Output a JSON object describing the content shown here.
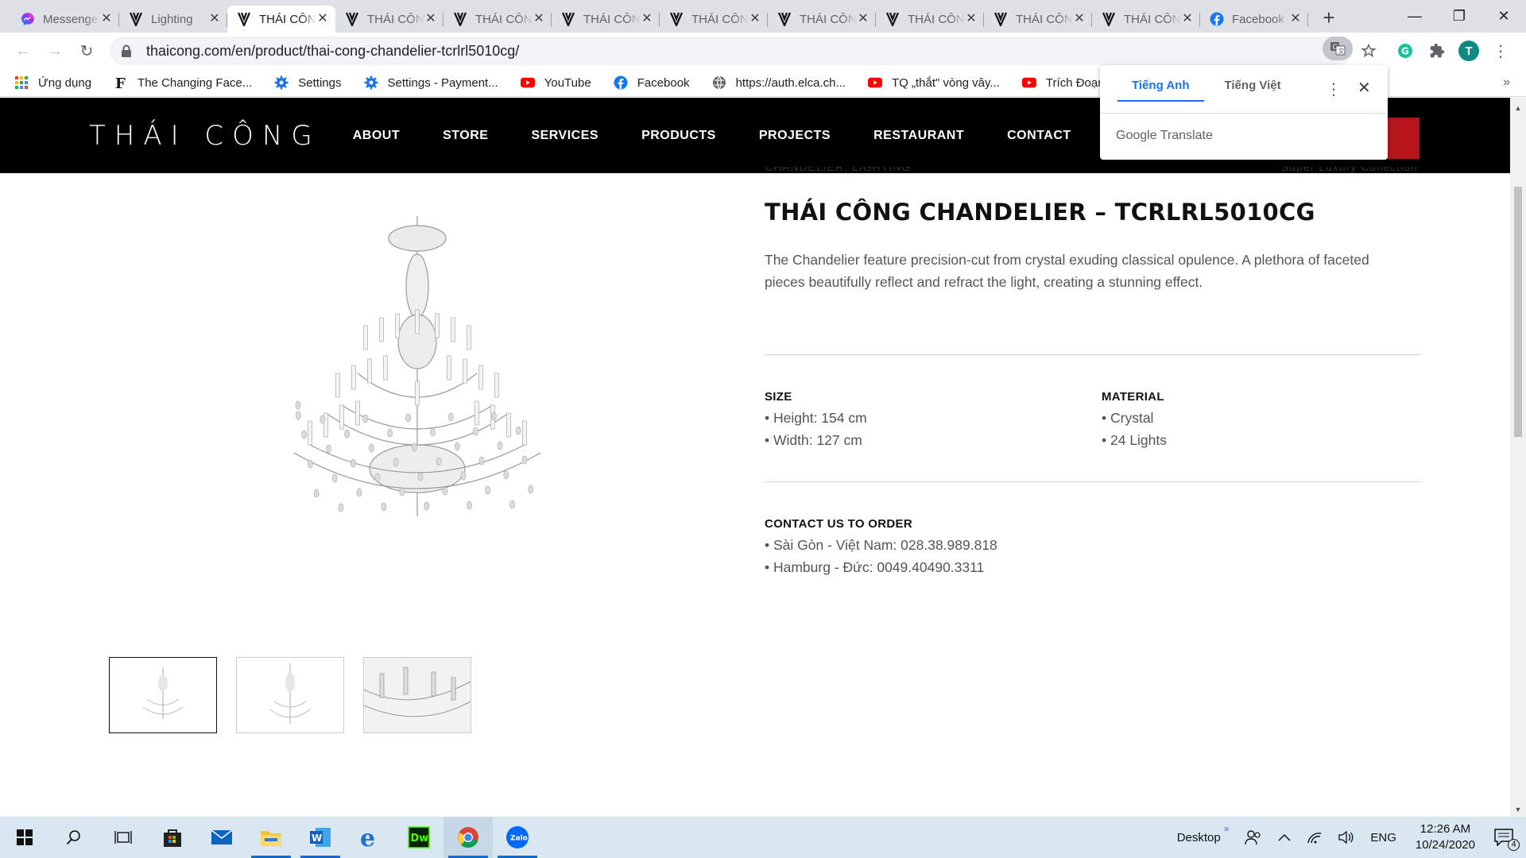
{
  "browser": {
    "tabs": [
      {
        "title": "Messenger",
        "icon": "messenger-icon",
        "active": false
      },
      {
        "title": "Lighting",
        "icon": "thaicong-icon",
        "active": false
      },
      {
        "title": "THÁI CÔNG",
        "icon": "thaicong-icon",
        "active": true
      },
      {
        "title": "THÁI CÔNG",
        "icon": "thaicong-icon",
        "active": false
      },
      {
        "title": "THÁI CÔNG",
        "icon": "thaicong-icon",
        "active": false
      },
      {
        "title": "THÁI CÔNG",
        "icon": "thaicong-icon",
        "active": false
      },
      {
        "title": "THÁI CÔNG",
        "icon": "thaicong-icon",
        "active": false
      },
      {
        "title": "THÁI CÔNG",
        "icon": "thaicong-icon",
        "active": false
      },
      {
        "title": "THÁI CÔNG",
        "icon": "thaicong-icon",
        "active": false
      },
      {
        "title": "THÁI CÔNG",
        "icon": "thaicong-icon",
        "active": false
      },
      {
        "title": "THÁI CÔNG",
        "icon": "thaicong-icon",
        "active": false
      },
      {
        "title": "Facebook",
        "icon": "facebook-icon",
        "active": false
      }
    ],
    "url": "thaicong.com/en/product/thai-cong-chandelier-tcrlrl5010cg/",
    "profile_initial": "T",
    "bookmarks": [
      {
        "label": "Ứng dụng",
        "icon": "apps-grid-icon"
      },
      {
        "label": "The Changing Face...",
        "icon": "f-logo-icon"
      },
      {
        "label": "Settings",
        "icon": "gear-icon"
      },
      {
        "label": "Settings - Payment...",
        "icon": "gear-icon"
      },
      {
        "label": "YouTube",
        "icon": "youtube-icon"
      },
      {
        "label": "Facebook",
        "icon": "facebook-icon"
      },
      {
        "label": "https://auth.elca.ch...",
        "icon": "globe-icon"
      },
      {
        "label": "TQ „thắt\" vòng vây...",
        "icon": "youtube-icon"
      },
      {
        "label": "Trích Đoạn Đêm lạ...",
        "icon": "youtube-icon"
      }
    ]
  },
  "translate_popup": {
    "tab_source": "Tiếng Anh",
    "tab_target": "Tiếng Việt",
    "brand": "Google Translate"
  },
  "site": {
    "logo": "THÁI CÔNG",
    "nav": [
      "ABOUT",
      "STORE",
      "SERVICES",
      "PRODUCTS",
      "PROJECTS",
      "RESTAURANT",
      "CONTACT"
    ],
    "accent": "#b4161b"
  },
  "product": {
    "category_cut": "CHANDELIER, LIGHTING",
    "collection_cut": "Super Luxury Collection",
    "title": "THÁI CÔNG CHANDELIER – TCRLRL5010CG",
    "description": "The Chandelier feature precision-cut from crystal exuding classical opulence. A plethora of faceted pieces beautifully reflect and refract the light, creating a stunning effect.",
    "size_heading": "SIZE",
    "size_lines": [
      "• Height: 154 cm",
      "• Width: 127 cm"
    ],
    "material_heading": "MATERIAL",
    "material_lines": [
      "• Crystal",
      "• 24 Lights"
    ],
    "contact_heading": "CONTACT US TO ORDER",
    "contact_lines": [
      "• Sài Gòn - Việt Nam: 028.38.989.818",
      "• Hamburg - Đức: 0049.40490.3311"
    ],
    "thumbnails": 3
  },
  "taskbar": {
    "desktop_label": "Desktop",
    "language": "ENG",
    "time": "12:26 AM",
    "date": "10/24/2020",
    "notification_count": "4"
  }
}
